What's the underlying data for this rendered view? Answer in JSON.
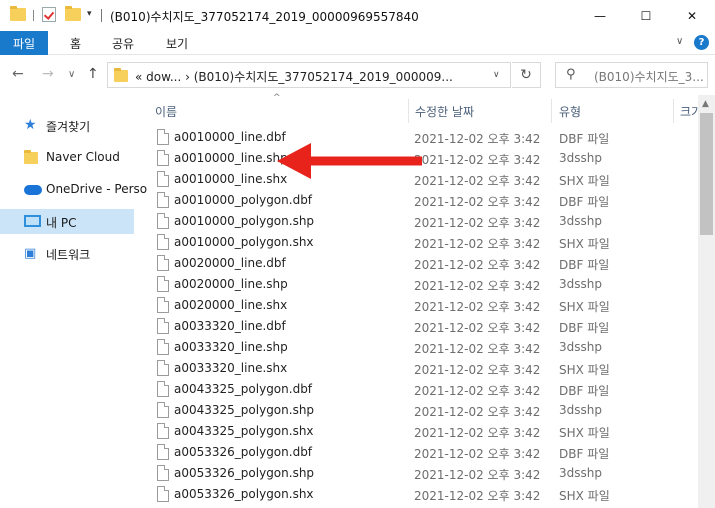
{
  "window": {
    "title": "(B010)수치지도_377052174_2019_00000969557840",
    "minimize_glyph": "—",
    "maximize_glyph": "☐",
    "close_glyph": "✕"
  },
  "quick_access": {
    "dropdown_glyph": "▾"
  },
  "ribbon": {
    "tabs": [
      "파일",
      "홈",
      "공유",
      "보기"
    ],
    "expand_glyph": "∨",
    "help_glyph": "?"
  },
  "navigation": {
    "back_glyph": "←",
    "forward_glyph": "→",
    "recent_glyph": "∨",
    "up_glyph": "↑",
    "address_text": "«  dow...  ›  (B010)수치지도_377052174_2019_000009...",
    "address_dropdown_glyph": "∨",
    "refresh_glyph": "↻",
    "search_icon_glyph": "⚲",
    "search_placeholder": "(B010)수치지도_3..."
  },
  "nav_pane": {
    "items": [
      {
        "label": "즐겨찾기",
        "icon": "star-icon",
        "selected": false
      },
      {
        "label": "Naver Cloud",
        "icon": "folder-icon",
        "selected": false
      },
      {
        "label": "OneDrive - Perso",
        "icon": "cloud-icon",
        "selected": false
      },
      {
        "label": "내 PC",
        "icon": "computer-icon",
        "selected": true
      },
      {
        "label": "네트워크",
        "icon": "network-icon",
        "selected": false
      }
    ]
  },
  "columns": {
    "name": "이름",
    "date": "수정한 날짜",
    "type": "유형",
    "size": "크기"
  },
  "files": [
    {
      "name": "a0010000_line.dbf",
      "date": "2021-12-02 오후 3:42",
      "type": "DBF 파일"
    },
    {
      "name": "a0010000_line.shp",
      "date": "2021-12-02 오후 3:42",
      "type": "3dsshp"
    },
    {
      "name": "a0010000_line.shx",
      "date": "2021-12-02 오후 3:42",
      "type": "SHX 파일"
    },
    {
      "name": "a0010000_polygon.dbf",
      "date": "2021-12-02 오후 3:42",
      "type": "DBF 파일"
    },
    {
      "name": "a0010000_polygon.shp",
      "date": "2021-12-02 오후 3:42",
      "type": "3dsshp"
    },
    {
      "name": "a0010000_polygon.shx",
      "date": "2021-12-02 오후 3:42",
      "type": "SHX 파일"
    },
    {
      "name": "a0020000_line.dbf",
      "date": "2021-12-02 오후 3:42",
      "type": "DBF 파일"
    },
    {
      "name": "a0020000_line.shp",
      "date": "2021-12-02 오후 3:42",
      "type": "3dsshp"
    },
    {
      "name": "a0020000_line.shx",
      "date": "2021-12-02 오후 3:42",
      "type": "SHX 파일"
    },
    {
      "name": "a0033320_line.dbf",
      "date": "2021-12-02 오후 3:42",
      "type": "DBF 파일"
    },
    {
      "name": "a0033320_line.shp",
      "date": "2021-12-02 오후 3:42",
      "type": "3dsshp"
    },
    {
      "name": "a0033320_line.shx",
      "date": "2021-12-02 오후 3:42",
      "type": "SHX 파일"
    },
    {
      "name": "a0043325_polygon.dbf",
      "date": "2021-12-02 오후 3:42",
      "type": "DBF 파일"
    },
    {
      "name": "a0043325_polygon.shp",
      "date": "2021-12-02 오후 3:42",
      "type": "3dsshp"
    },
    {
      "name": "a0043325_polygon.shx",
      "date": "2021-12-02 오후 3:42",
      "type": "SHX 파일"
    },
    {
      "name": "a0053326_polygon.dbf",
      "date": "2021-12-02 오후 3:42",
      "type": "DBF 파일"
    },
    {
      "name": "a0053326_polygon.shp",
      "date": "2021-12-02 오후 3:42",
      "type": "3dsshp"
    },
    {
      "name": "a0053326_polygon.shx",
      "date": "2021-12-02 오후 3:42",
      "type": "SHX 파일"
    }
  ],
  "colors": {
    "accent": "#1979ca",
    "selected_nav": "#cce4f7",
    "annotation_arrow": "#e8231c"
  }
}
